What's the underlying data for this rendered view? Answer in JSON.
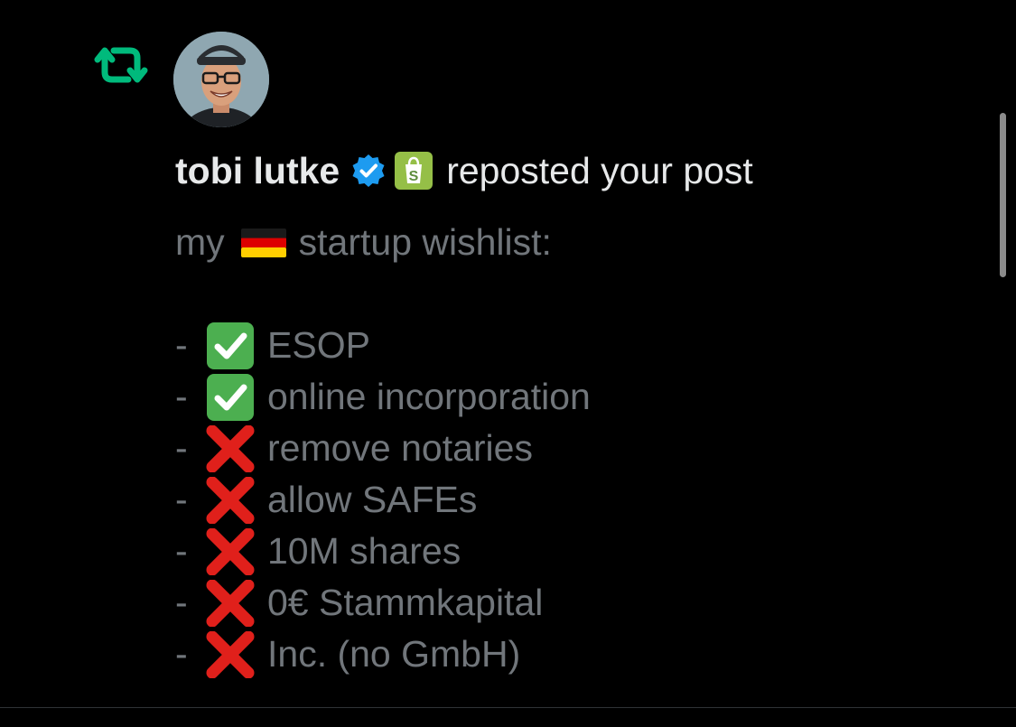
{
  "notification": {
    "author_name": "tobi lutke",
    "action_text": "reposted your post",
    "icons": {
      "repost": "repost-icon",
      "verified": "verified-badge-icon",
      "brand": "shopify-bag-icon",
      "avatar": "avatar"
    },
    "colors": {
      "repost_green": "#00ba7c",
      "verified_blue": "#1d9bf0",
      "shopify_green": "#95bf47",
      "check_green": "#4caf50",
      "cross_red": "#e0201b",
      "muted_text": "#71767b",
      "primary_text": "#e7e9ea",
      "background": "#000000"
    }
  },
  "post": {
    "intro_prefix": "my",
    "intro_flag": "germany-flag-icon",
    "intro_suffix": "startup wishlist:",
    "items": [
      {
        "bullet": "-",
        "status": "check",
        "text": "ESOP"
      },
      {
        "bullet": "-",
        "status": "check",
        "text": "online incorporation"
      },
      {
        "bullet": "-",
        "status": "cross",
        "text": "remove notaries"
      },
      {
        "bullet": "-",
        "status": "cross",
        "text": "allow SAFEs"
      },
      {
        "bullet": "-",
        "status": "cross",
        "text": "10M shares"
      },
      {
        "bullet": "-",
        "status": "cross",
        "text": "0€ Stammkapital"
      },
      {
        "bullet": "-",
        "status": "cross",
        "text": "Inc. (no GmbH)"
      }
    ]
  }
}
